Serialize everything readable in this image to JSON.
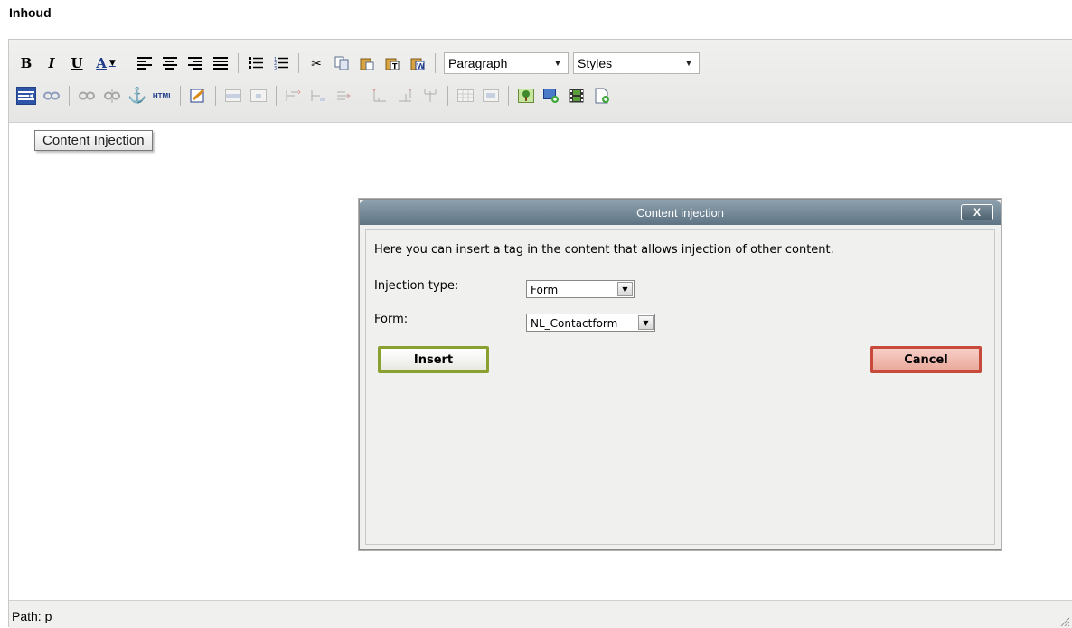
{
  "section_title": "Inhoud",
  "toolbar": {
    "bold": "B",
    "italic": "I",
    "underline": "U",
    "forecolor": "A",
    "format_select": "Paragraph",
    "styles_select": "Styles",
    "html_label": "HTML"
  },
  "tooltip": "Content Injection",
  "dialog": {
    "title": "Content injection",
    "close": "X",
    "intro": "Here you can insert a tag in the content that allows injection of other content.",
    "injection_type_label": "Injection type:",
    "injection_type_value": "Form",
    "form_label": "Form:",
    "form_value": "NL_Contactform",
    "insert_label": "Insert",
    "cancel_label": "Cancel"
  },
  "status": "Path: p",
  "colors": {
    "accent": "#5e7484",
    "insert_border": "#8aa030",
    "cancel_border": "#c84a3a"
  }
}
